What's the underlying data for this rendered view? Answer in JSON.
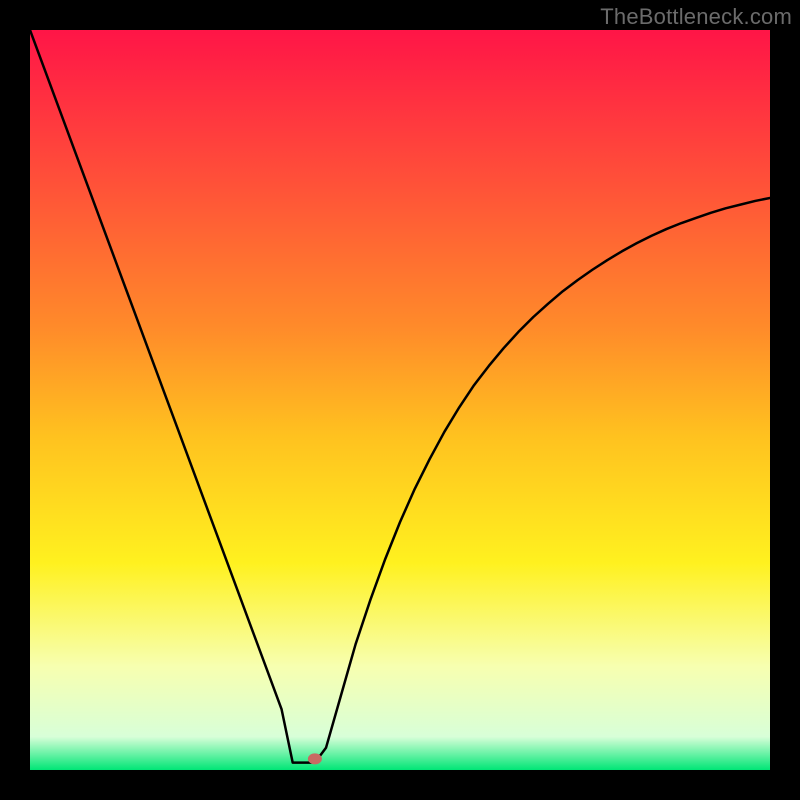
{
  "watermark": "TheBottleneck.com",
  "chart_data": {
    "type": "line",
    "title": "",
    "xlabel": "",
    "ylabel": "",
    "xlim": [
      0,
      100
    ],
    "ylim": [
      0,
      100
    ],
    "x": [
      0,
      2,
      4,
      6,
      8,
      10,
      12,
      14,
      16,
      18,
      20,
      22,
      24,
      26,
      28,
      30,
      32,
      34,
      36,
      38,
      40,
      42,
      44,
      46,
      48,
      50,
      52,
      54,
      56,
      58,
      60,
      62,
      64,
      66,
      68,
      70,
      72,
      74,
      76,
      78,
      80,
      82,
      84,
      86,
      88,
      90,
      92,
      94,
      96,
      98,
      100
    ],
    "y": [
      100,
      94.6,
      89.2,
      83.8,
      78.4,
      73.0,
      67.6,
      62.2,
      56.8,
      51.4,
      46.0,
      40.6,
      35.2,
      29.8,
      24.4,
      19.0,
      13.6,
      8.2,
      2.8,
      1.0,
      3.0,
      10.0,
      17.0,
      23.0,
      28.5,
      33.5,
      38.0,
      42.0,
      45.7,
      49.0,
      52.0,
      54.6,
      57.0,
      59.2,
      61.2,
      63.0,
      64.7,
      66.2,
      67.6,
      68.9,
      70.1,
      71.2,
      72.2,
      73.1,
      73.9,
      74.6,
      75.3,
      75.9,
      76.4,
      76.9,
      77.3
    ],
    "flat_segment": {
      "x_start": 35.5,
      "x_end": 38.5,
      "y": 1.0
    },
    "marker": {
      "x": 38.5,
      "y": 1.5,
      "color": "#c86a63"
    },
    "background_gradient": {
      "stops": [
        {
          "offset": 0.0,
          "color": "#ff1547"
        },
        {
          "offset": 0.2,
          "color": "#ff4f39"
        },
        {
          "offset": 0.4,
          "color": "#ff8a2a"
        },
        {
          "offset": 0.55,
          "color": "#ffc21f"
        },
        {
          "offset": 0.72,
          "color": "#fff11f"
        },
        {
          "offset": 0.86,
          "color": "#f7ffb0"
        },
        {
          "offset": 0.955,
          "color": "#d8ffd8"
        },
        {
          "offset": 1.0,
          "color": "#00e676"
        }
      ]
    }
  }
}
